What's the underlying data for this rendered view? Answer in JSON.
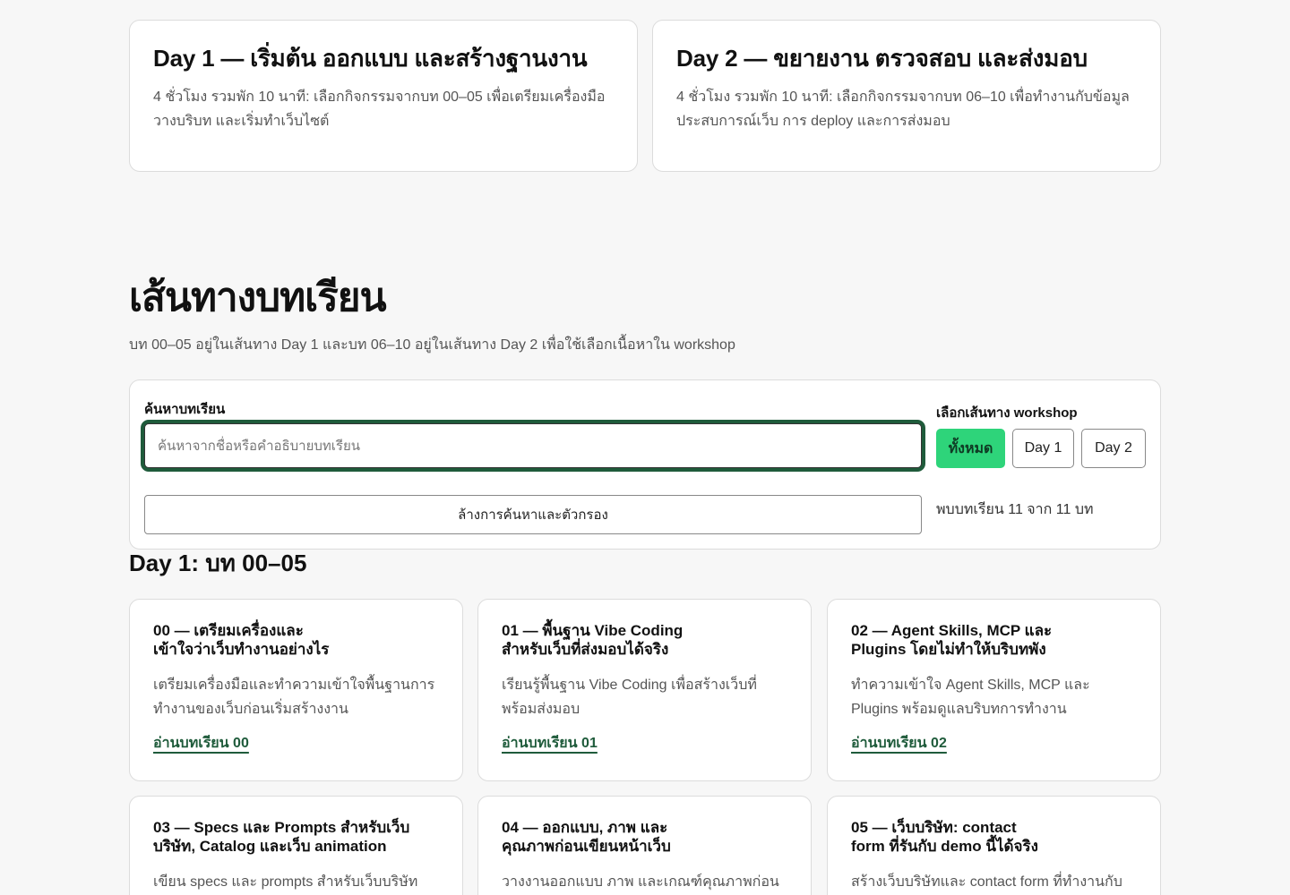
{
  "day_cards": [
    {
      "title": "Day 1 — เริ่มต้น ออกแบบ และสร้างฐานงาน",
      "description": "4 ชั่วโมง รวมพัก 10 นาที: เลือกกิจกรรมจากบท 00–05 เพื่อเตรียมเครื่องมือ วางบริบท และเริ่มทำเว็บไซต์"
    },
    {
      "title": "Day 2 — ขยายงาน ตรวจสอบ และส่งมอบ",
      "description": "4 ชั่วโมง รวมพัก 10 นาที: เลือกกิจกรรมจากบท 06–10 เพื่อทำงานกับข้อมูล ประสบการณ์เว็บ การ deploy และการส่งมอบ"
    }
  ],
  "section": {
    "title": "เส้นทางบทเรียน",
    "description": "บท 00–05 อยู่ในเส้นทาง Day 1 และบท 06–10 อยู่ในเส้นทาง Day 2 เพื่อใช้เลือกเนื้อหาใน workshop"
  },
  "filter": {
    "search_label": "ค้นหาบทเรียน",
    "search_placeholder": "ค้นหาจากชื่อหรือคำอธิบายบทเรียน",
    "search_value": "",
    "clear_label": "ล้างการค้นหาและตัวกรอง",
    "track_label": "เลือกเส้นทาง workshop",
    "tracks": [
      "ทั้งหมด",
      "Day 1",
      "Day 2"
    ],
    "active_track": "ทั้งหมด",
    "result_text": "พบบทเรียน 11 จาก 11 บท"
  },
  "group": {
    "title": "Day 1: บท 00–05",
    "lessons": [
      {
        "title": "00 — เตรียมเครื่องและเข้าใจว่าเว็บทำงานอย่างไร",
        "description": "เตรียมเครื่องมือและทำความเข้าใจพื้นฐานการทำงานของเว็บก่อนเริ่มสร้างงาน",
        "link": "อ่านบทเรียน 00"
      },
      {
        "title": "01 — พื้นฐาน Vibe Coding สำหรับเว็บที่ส่งมอบได้จริง",
        "description": "เรียนรู้พื้นฐาน Vibe Coding เพื่อสร้างเว็บที่พร้อมส่งมอบ",
        "link": "อ่านบทเรียน 01"
      },
      {
        "title": "02 — Agent Skills, MCP และ Plugins โดยไม่ทำให้บริบทพัง",
        "description": "ทำความเข้าใจ Agent Skills, MCP และ Plugins พร้อมดูแลบริบทการทำงาน",
        "link": "อ่านบทเรียน 02"
      },
      {
        "title": "03 — Specs และ Prompts สำหรับเว็บบริษัท, Catalog และเว็บ animation",
        "description": "เขียน specs และ prompts สำหรับเว็บบริษัท",
        "link": ""
      },
      {
        "title": "04 — ออกแบบ, ภาพ และคุณภาพก่อนเขียนหน้าเว็บ",
        "description": "วางงานออกแบบ ภาพ และเกณฑ์คุณภาพก่อนเริ่ม",
        "link": ""
      },
      {
        "title": "05 — เว็บบริษัท: contact form ที่รันกับ demo นี้ได้จริง",
        "description": "สร้างเว็บบริษัทและ contact form ที่ทำงานกับ",
        "link": ""
      }
    ]
  }
}
